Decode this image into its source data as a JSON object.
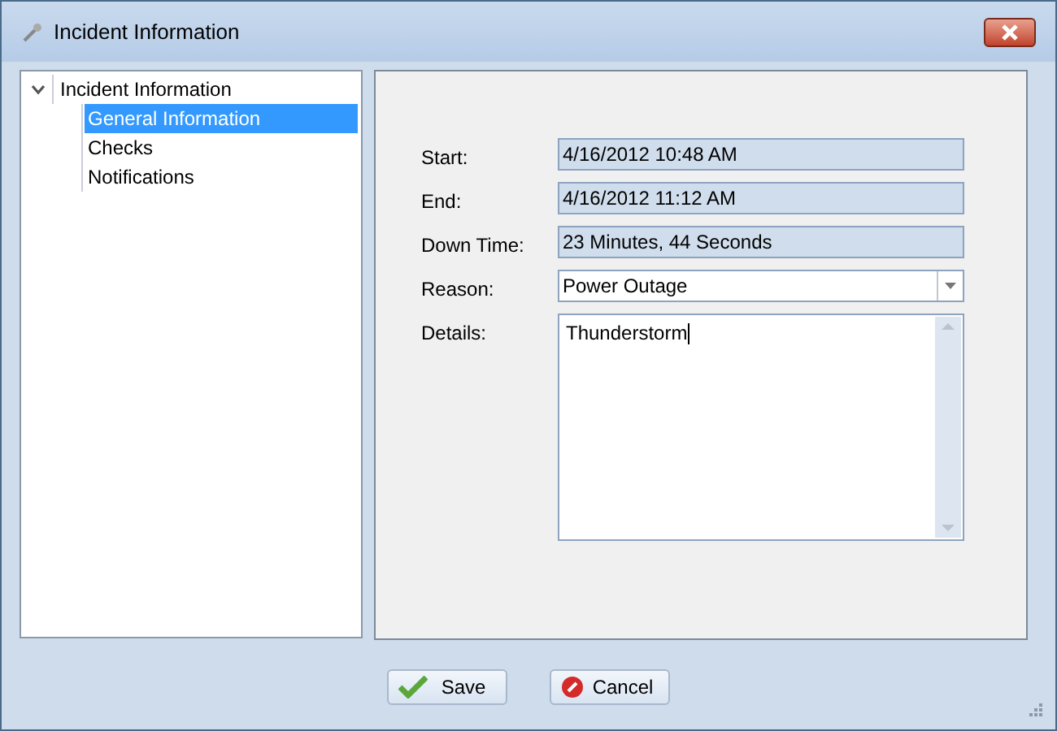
{
  "window": {
    "title": "Incident Information"
  },
  "tree": {
    "label": "Incident Information",
    "expanded": true,
    "children": [
      {
        "label": "General Information",
        "selected": true
      },
      {
        "label": "Checks",
        "selected": false
      },
      {
        "label": "Notifications",
        "selected": false
      }
    ]
  },
  "fields": [
    {
      "label": "Start:",
      "kind": "readonly",
      "value": "4/16/2012 10:48 AM"
    },
    {
      "label": "End:",
      "kind": "readonly",
      "value": "4/16/2012 11:12 AM"
    },
    {
      "label": "Down Time:",
      "kind": "readonly",
      "value": "23 Minutes, 44 Seconds"
    },
    {
      "label": "Reason:",
      "kind": "dropdown",
      "value": "Power Outage"
    },
    {
      "label": "Details:",
      "kind": "textarea",
      "value": "Thunderstorm"
    }
  ],
  "buttons": [
    {
      "label": "Save",
      "kind": "save"
    },
    {
      "label": "Cancel",
      "kind": "cancel"
    }
  ]
}
